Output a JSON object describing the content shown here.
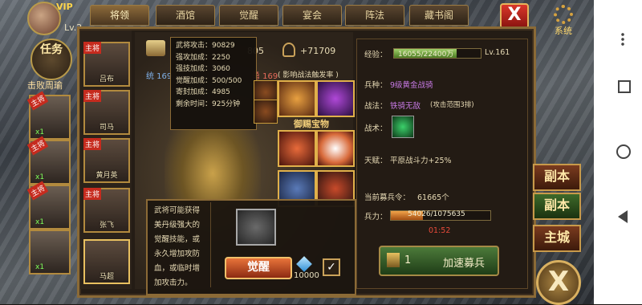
{
  "top": {
    "vip": "VIP",
    "level_label": "Lv.2",
    "tabs": [
      "将领",
      "酒馆",
      "觉醒",
      "宴会",
      "阵法",
      "藏书阁"
    ],
    "system_label": "系统",
    "close_symbol": "X"
  },
  "left": {
    "task_label": "任务",
    "task_caption": "击败周瑜",
    "cards": [
      {
        "tag": "主将",
        "count": "x1"
      },
      {
        "tag": "主将",
        "count": "x1"
      },
      {
        "tag": "主将",
        "count": "x1"
      },
      {
        "tag": "",
        "count": "x1"
      }
    ]
  },
  "roster": [
    {
      "tag": "主将",
      "name": "吕布"
    },
    {
      "tag": "主将",
      "name": "司马"
    },
    {
      "tag": "主将",
      "name": "黄月英"
    },
    {
      "tag": "主将",
      "name": "张飞"
    },
    {
      "tag": "",
      "name": "马超"
    }
  ],
  "stats": {
    "power_partial": "805",
    "power_bonus": "+71709",
    "command_label": "统 169",
    "brave_label": "勇 169",
    "note": "( 影响战法触发率 )"
  },
  "tooltip": {
    "lines": [
      "武将攻击：90829",
      "强攻加成：2250",
      "强技加成：3060",
      "觉醒加成：500/500",
      "寄封加成：4985",
      "剩余时间：925分钟"
    ]
  },
  "treasure_label": "御赐宝物",
  "awaken": {
    "description": "武将可能获得美丹级强大的觉醒技能，或永久增加攻防血，或临时增加攻击力。",
    "button_label": "觉醒",
    "gem_count": "10000",
    "check_symbol": "✓"
  },
  "right": {
    "exp_label": "经验：",
    "exp_value": "16055/22400万",
    "exp_ratio": 0.72,
    "level": "Lv.161",
    "soldier_label": "兵种：",
    "soldier_value": "9级黄金战骑",
    "tactic_label": "战法：",
    "tactic_value": "铁骑无敌",
    "tactic_note": "(攻击范围3排)",
    "skill_label": "战术：",
    "talent_label": "天赋：",
    "talent_value": "平原战斗力+25%",
    "recruit_label": "当前募兵令：",
    "recruit_value": "61665个",
    "troop_label": "兵力：",
    "troop_value": "54026/1075635",
    "troop_ratio": 0.32,
    "timer": "01:52",
    "speed_count": "1",
    "speed_label": "加速募兵"
  },
  "side_buttons": [
    "副本",
    "副本",
    "主城"
  ],
  "big_close_symbol": "X",
  "colors": {
    "accent": "#b28a3e",
    "close_red": "#d9362a",
    "exp_green": "#9fd06a"
  }
}
